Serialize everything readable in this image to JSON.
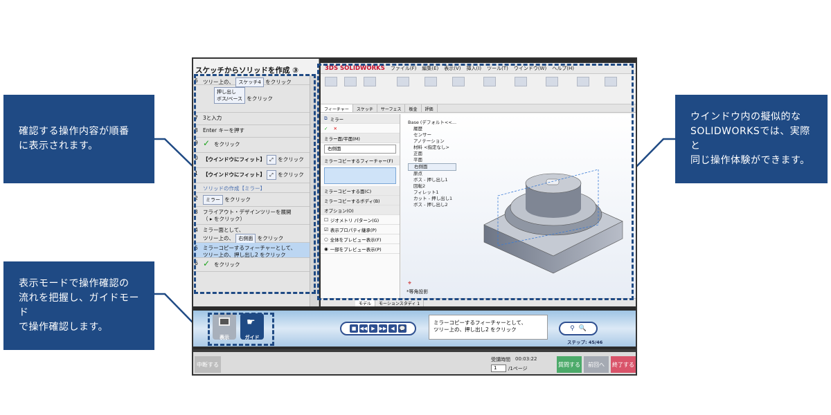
{
  "callouts": {
    "left_top": "確認する操作内容が順番\nに表示されます。",
    "left_bottom": "表示モードで操作確認の\n流れを把握し、ガイドモード\nで操作確認します。",
    "right": "ウインドウ内の擬似的な\nSOLIDWORKSでは、実際と\n同じ操作体験ができます。"
  },
  "guide": {
    "title": "スケッチからソリッドを作成 ③",
    "steps": [
      {
        "num": "6",
        "text": "ツリー上の、",
        "chip": "スケッチ4",
        "after": "をクリック"
      },
      {
        "num": "",
        "text": "押し出し\nボス/ベース",
        "after": "をクリック"
      },
      {
        "num": "7",
        "text": "3と入力"
      },
      {
        "num": "8",
        "text": "Enter キーを押す"
      },
      {
        "num": "9",
        "text": "をクリック"
      },
      {
        "num": "0",
        "text": "【ウインドウにフィット】",
        "after": "をクリック"
      },
      {
        "num": "1",
        "text": "【ウインドウにフィット】",
        "after": "をクリック"
      },
      {
        "num": "",
        "text": "ソリッドの作成【ミラー】"
      },
      {
        "num": "2",
        "text": "ミラー",
        "after": "をクリック"
      },
      {
        "num": "3",
        "text": "フライアウト・デザインツリーを展開\n（ ▸ をクリック）"
      },
      {
        "num": "4",
        "text": "ミラー面として、\nツリー上の、",
        "chip": "右側面",
        "after": "をクリック"
      },
      {
        "num": "5",
        "text": "ミラーコピーするフィーチャーとして、\nツリー上の、押し出し2 をクリック"
      },
      {
        "num": "6",
        "text": "をクリック"
      }
    ]
  },
  "sw": {
    "logo": "3DS SOLIDWORKS",
    "menu": [
      "ファイル(F)",
      "編集(E)",
      "表示(V)",
      "挿入(I)",
      "ツール(T)",
      "ウインドウ(W)",
      "ヘルプ(H)"
    ],
    "tabs": [
      "フィーチャー",
      "スケッチ",
      "サーフェス",
      "板金",
      "評価"
    ],
    "pm": {
      "title": "ミラー",
      "mirror_face_label": "ミラー面/平面(M)",
      "mirror_face_value": "右側面",
      "features_label": "ミラーコピーするフィーチャー(F)",
      "faces_label": "ミラーコピーする面(C)",
      "bodies_label": "ミラーコピーするボディ(B)",
      "options_label": "オプション(O)",
      "opt1": "ジオメトリ パターン(G)",
      "opt2": "表示プロパティ継承(P)",
      "opt3": "全体をプレビュー表示(F)",
      "opt4": "一部をプレビュー表示(P)"
    },
    "tree": [
      "Base (デフォルト<<...",
      "履歴",
      "センサー",
      "アノテーション",
      "材料 <指定なし>",
      "正面",
      "平面",
      "右側面",
      "原点",
      "ボス - 押し出し1",
      "回転2",
      "フィレット1",
      "カット - 押し出し1",
      "ボス - 押し出し2"
    ],
    "view_label": "*等角投影",
    "bottom_tabs": [
      "モデル",
      "モーションスタディ 1"
    ]
  },
  "ctrl": {
    "mode_view": "表示",
    "mode_guide": "ガイド",
    "message": "ミラーコピーするフィーチャーとして、\nツリー上の、押し出し2 をクリック",
    "step_label": "ステップ: 45/46"
  },
  "footer": {
    "suspend": "中断する",
    "elapsed_label": "受講時間",
    "elapsed_value": "00:03:22",
    "page_value": "1",
    "page_suffix": "/1ページ",
    "btn_help": "質問する",
    "btn_prev": "前回へ",
    "btn_end": "終了する"
  }
}
